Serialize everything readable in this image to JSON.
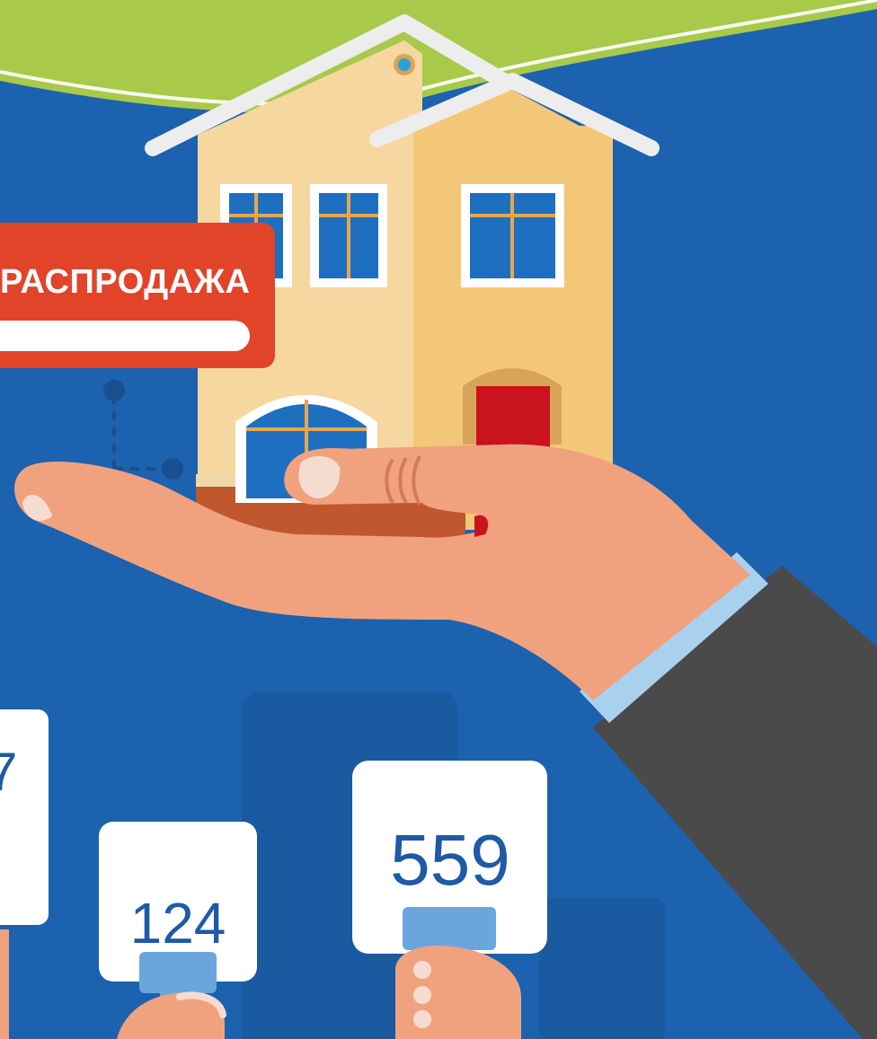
{
  "sale_sign": {
    "label": "РАСПРОДАЖА"
  },
  "paddles": [
    {
      "number": "124"
    },
    {
      "number": "559"
    }
  ],
  "colors": {
    "background": "#1c62ae",
    "sky": "#a9c94a",
    "sign": "#e2442a",
    "house_left": "#f6d7a0",
    "house_right": "#f3c778",
    "skin": "#f0a27f",
    "sleeve": "#4a4a4a",
    "cuff": "#a9d1ee",
    "paddle_number": "#1f5aa6"
  }
}
